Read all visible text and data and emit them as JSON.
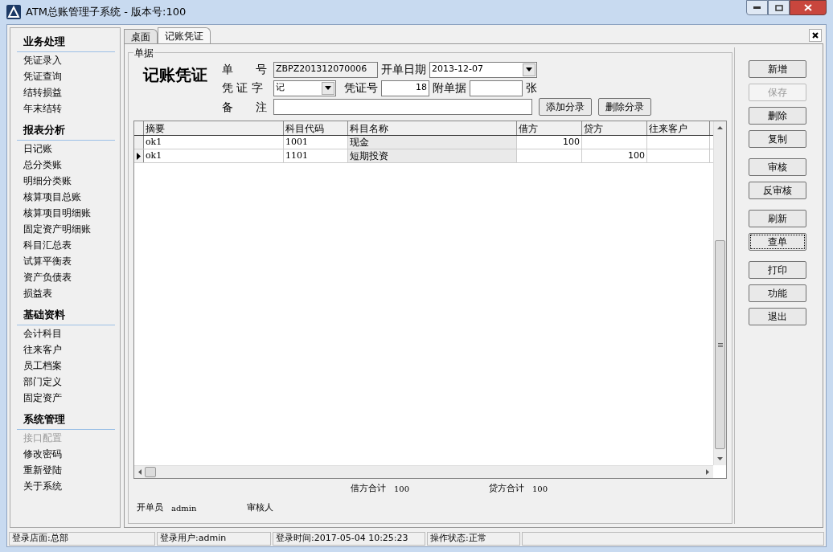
{
  "window": {
    "title": "ATM总账管理子系统 - 版本号:100"
  },
  "sidebar": {
    "sections": [
      {
        "title": "业务处理",
        "items": [
          {
            "label": "凭证录入",
            "disabled": false
          },
          {
            "label": "凭证查询",
            "disabled": false
          },
          {
            "label": "结转损益",
            "disabled": false
          },
          {
            "label": "年末结转",
            "disabled": false
          }
        ]
      },
      {
        "title": "报表分析",
        "items": [
          {
            "label": "日记账",
            "disabled": false
          },
          {
            "label": "总分类账",
            "disabled": false
          },
          {
            "label": "明细分类账",
            "disabled": false
          },
          {
            "label": "核算项目总账",
            "disabled": false
          },
          {
            "label": "核算项目明细账",
            "disabled": false
          },
          {
            "label": "固定资产明细账",
            "disabled": false
          },
          {
            "label": "科目汇总表",
            "disabled": false
          },
          {
            "label": "试算平衡表",
            "disabled": false
          },
          {
            "label": "资产负债表",
            "disabled": false
          },
          {
            "label": "损益表",
            "disabled": false
          }
        ]
      },
      {
        "title": "基础资料",
        "items": [
          {
            "label": "会计科目",
            "disabled": false
          },
          {
            "label": "往来客户",
            "disabled": false
          },
          {
            "label": "员工档案",
            "disabled": false
          },
          {
            "label": "部门定义",
            "disabled": false
          },
          {
            "label": "固定资产",
            "disabled": false
          }
        ]
      },
      {
        "title": "系统管理",
        "items": [
          {
            "label": "接口配置",
            "disabled": true
          },
          {
            "label": "修改密码",
            "disabled": false
          },
          {
            "label": "重新登陆",
            "disabled": false
          },
          {
            "label": "关于系统",
            "disabled": false
          }
        ]
      }
    ]
  },
  "tabs": [
    {
      "label": "桌面",
      "selected": false
    },
    {
      "label": "记账凭证",
      "selected": true
    }
  ],
  "voucher": {
    "group_label": "单据",
    "heading": "记账凭证",
    "number_label": "单　　号",
    "number": "ZBPZ201312070006",
    "date_label": "开单日期",
    "date": "2013-12-07",
    "type_label": "凭 证 字",
    "type": "记",
    "seq_label": "凭证号",
    "seq": "18",
    "attach_label": "附单据",
    "attach_unit": "张",
    "note_label": "备　　注",
    "add_button": "添加分录",
    "delete_button": "删除分录"
  },
  "table": {
    "columns": [
      "摘要",
      "科目代码",
      "科目名称",
      "借方",
      "贷方",
      "往来客户"
    ],
    "rows": [
      {
        "selected": false,
        "cells": [
          "ok1",
          "1001",
          "现金",
          "100",
          "",
          ""
        ]
      },
      {
        "selected": true,
        "cells": [
          "ok1",
          "1101",
          "短期投资",
          "",
          "100",
          ""
        ]
      }
    ]
  },
  "totals": {
    "debit_label": "借方合计",
    "debit": "100",
    "credit_label": "贷方合计",
    "credit": "100"
  },
  "footer": {
    "creator_label": "开单员",
    "creator": "admin",
    "auditor_label": "审核人"
  },
  "button_groups": [
    [
      {
        "label": "新增",
        "disabled": false,
        "focused": false
      },
      {
        "label": "保存",
        "disabled": true,
        "focused": false
      },
      {
        "label": "删除",
        "disabled": false,
        "focused": false
      },
      {
        "label": "复制",
        "disabled": false,
        "focused": false
      }
    ],
    [
      {
        "label": "审核",
        "disabled": false,
        "focused": false
      },
      {
        "label": "反审核",
        "disabled": false,
        "focused": false
      }
    ],
    [
      {
        "label": "刷新",
        "disabled": false,
        "focused": false
      },
      {
        "label": "查单",
        "disabled": false,
        "focused": true
      }
    ],
    [
      {
        "label": "打印",
        "disabled": false,
        "focused": false
      },
      {
        "label": "功能",
        "disabled": false,
        "focused": false
      },
      {
        "label": "退出",
        "disabled": false,
        "focused": false
      }
    ]
  ],
  "status_bar": [
    "登录店面:总部",
    "登录用户:admin",
    "登录时间:2017-05-04 10:25:23",
    "操作状态:正常"
  ]
}
